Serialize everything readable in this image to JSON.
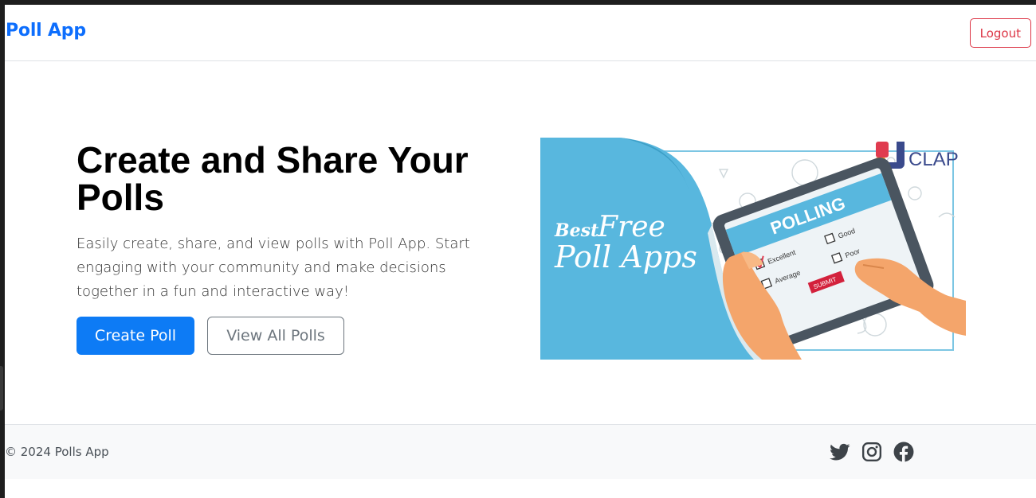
{
  "navbar": {
    "brand": "Poll App",
    "logout_label": "Logout"
  },
  "hero": {
    "title": "Create and Share Your Polls",
    "description": "Easily create, share, and view polls with Poll App. Start engaging with your community and make decisions together in a fun and interactive way!",
    "create_label": "Create Poll",
    "view_label": "View All Polls"
  },
  "banner": {
    "line1_best": "Best",
    "line1_free": "Free",
    "line2": "Poll Apps",
    "brand": "CLAP",
    "tablet_heading": "POLLING",
    "options": [
      "Excellent",
      "Good",
      "Average",
      "Poor"
    ],
    "submit": "SUBMIT"
  },
  "footer": {
    "copyright": "© 2024 Polls App",
    "icons": [
      "twitter-icon",
      "instagram-icon",
      "facebook-icon"
    ]
  },
  "colors": {
    "brand": "#0d6efd",
    "danger": "#dc3545",
    "primary_button": "#0d7bf5",
    "banner_blue": "#58b7de"
  }
}
